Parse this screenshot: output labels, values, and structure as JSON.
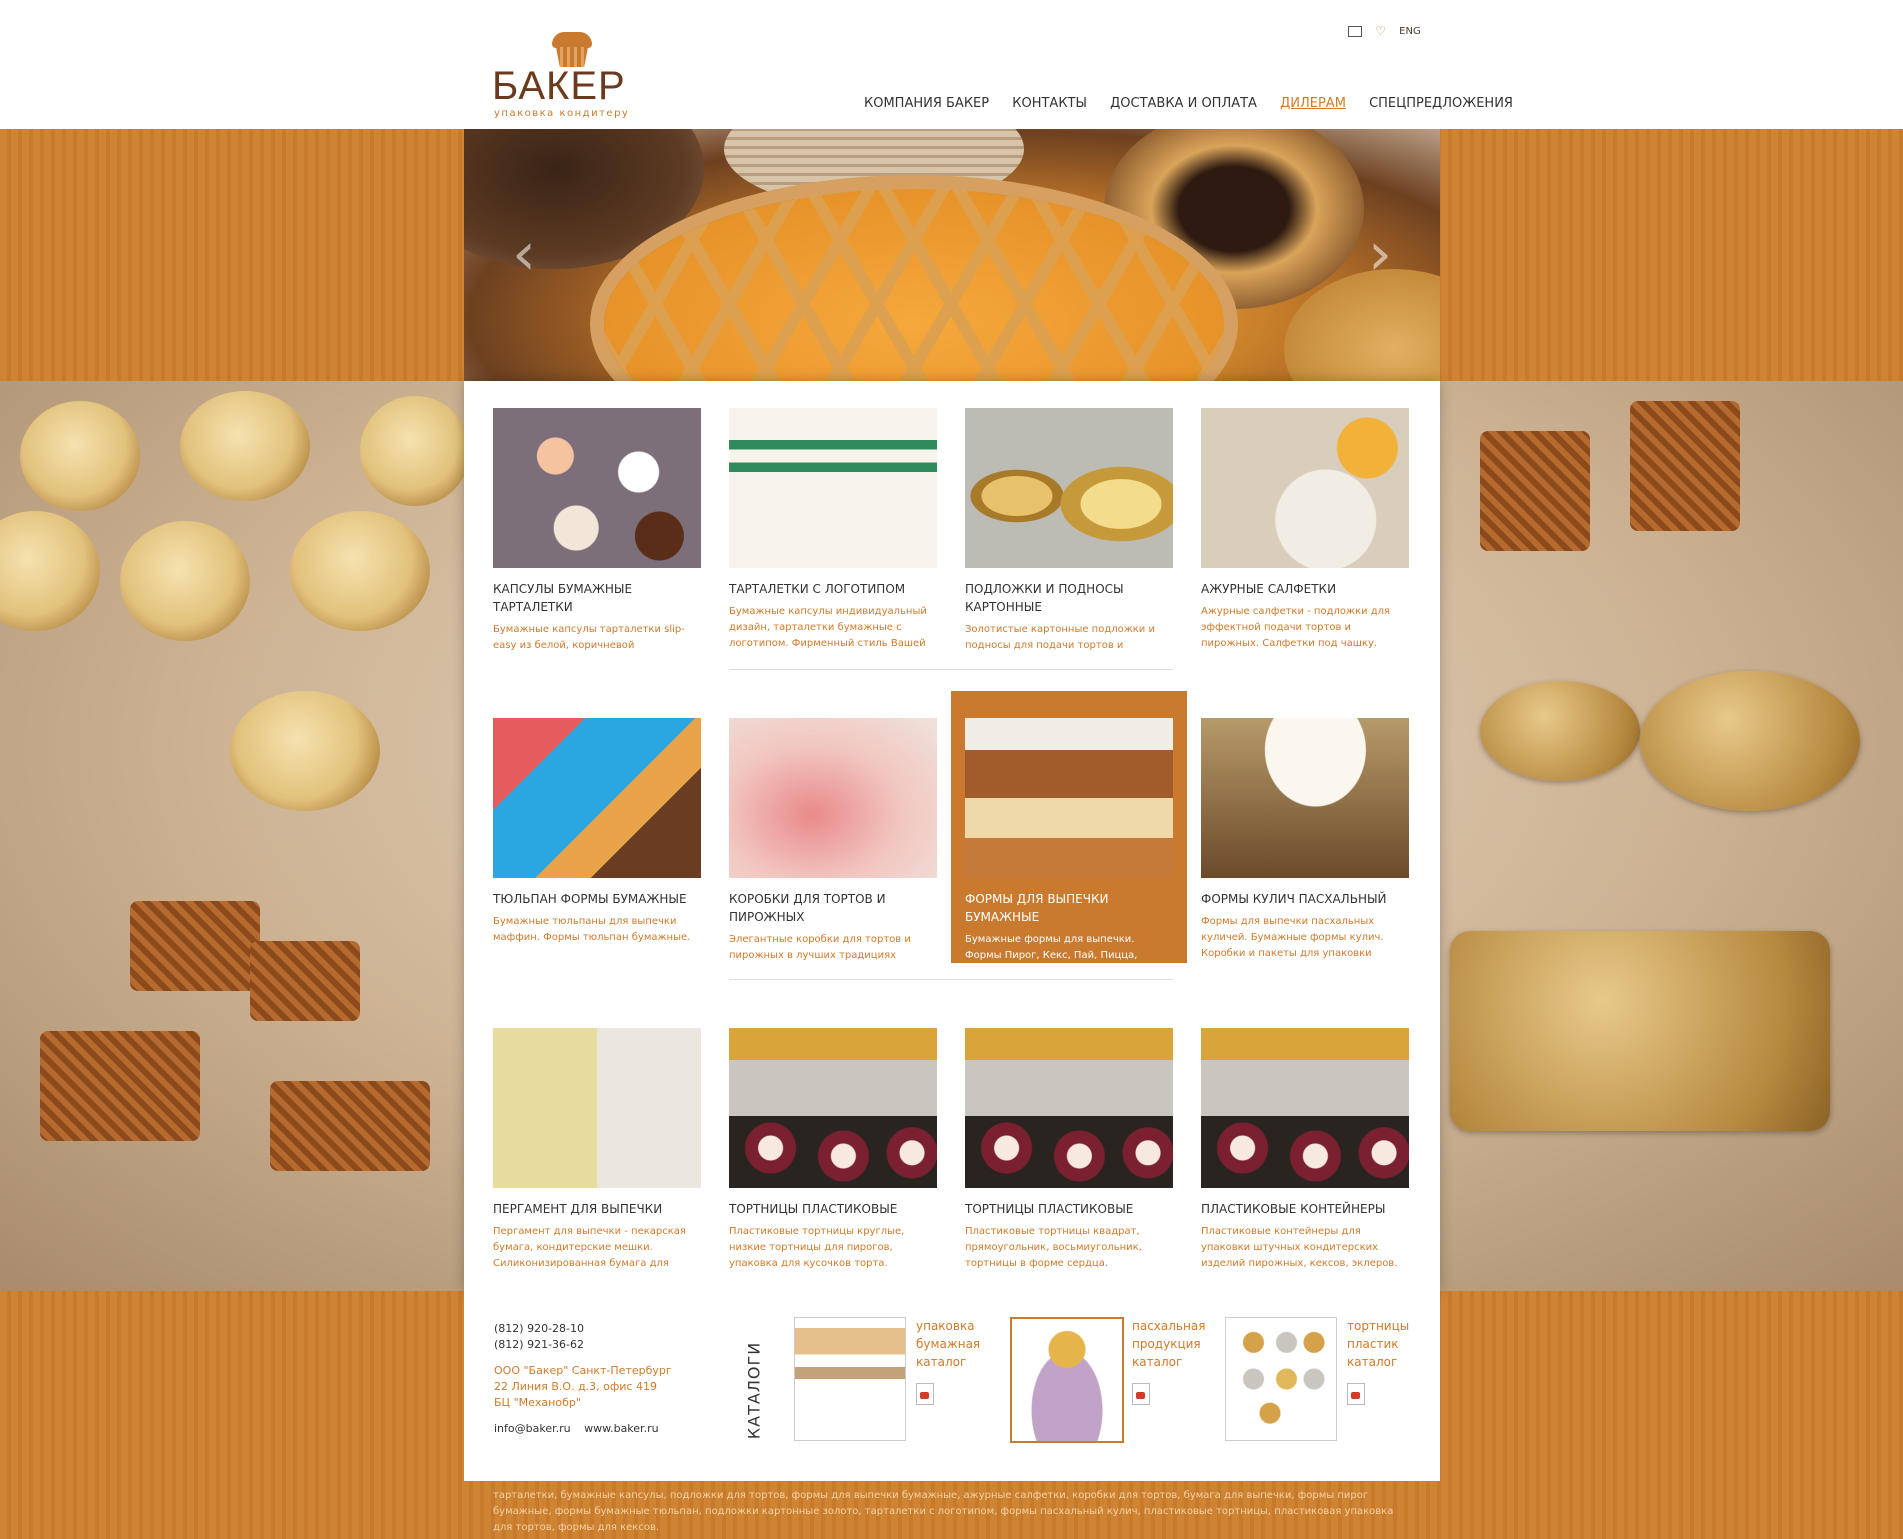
{
  "header": {
    "logo_title": "БАКЕР",
    "logo_sub": "упаковка кондитеру",
    "lang": "ENG",
    "nav": [
      {
        "label": "КОМПАНИЯ БАКЕР"
      },
      {
        "label": "КОНТАКТЫ"
      },
      {
        "label": "ДОСТАВКА И ОПЛАТА"
      },
      {
        "label": "ДИЛЕРАМ",
        "active": true
      },
      {
        "label": "СПЕЦПРЕДЛОЖЕНИЯ"
      }
    ]
  },
  "slider": {
    "prev_icon": "chevron-left-icon",
    "next_icon": "chevron-right-icon"
  },
  "products": [
    {
      "title": "КАПСУЛЫ БУМАЖНЫЕ ТАРТАЛЕТКИ",
      "desc": "Бумажные капсулы тарталетки slip-easy из белой, коричневой"
    },
    {
      "title": "ТАРТАЛЕТКИ С ЛОГОТИПОМ",
      "desc": "Бумажные капсулы индивидуальный дизайн, тарталетки бумажные с логотипом. Фирменный стиль Вашей"
    },
    {
      "title": "ПОДЛОЖКИ И ПОДНОСЫ КАРТОННЫЕ",
      "desc": "Золотистые картонные подложки и подносы для подачи тортов и"
    },
    {
      "title": "АЖУРНЫЕ САЛФЕТКИ",
      "desc": "Ажурные салфетки - подложки для эффектной подачи тортов и пирожных. Салфетки под чашку."
    },
    {
      "title": "ТЮЛЬПАН ФОРМЫ БУМАЖНЫЕ",
      "desc": "Бумажные тюльпаны для выпечки маффин. Формы тюльпан бумажные."
    },
    {
      "title": "КОРОБКИ ДЛЯ ТОРТОВ И ПИРОЖНЫХ",
      "desc": "Элегантные коробки для тортов и пирожных в лучших традициях"
    },
    {
      "title": "ФОРМЫ ДЛЯ ВЫПЕЧКИ БУМАЖНЫЕ",
      "desc": "Бумажные формы для выпечки. Формы Пирог, Кекс, Пай, Пицца, фигурные формы."
    },
    {
      "title": "ФОРМЫ КУЛИЧ ПАСХАЛЬНЫЙ",
      "desc": "Формы для выпечки пасхальных куличей. Бумажные формы кулич. Коробки и пакеты для упаковки"
    },
    {
      "title": "ПЕРГАМЕНТ ДЛЯ ВЫПЕЧКИ",
      "desc": "Пергамент для выпечки - пекарская бумага, кондитерские мешки. Силиконизированная бумага для"
    },
    {
      "title": "ТОРТНИЦЫ ПЛАСТИКОВЫЕ",
      "desc": "Пластиковые тортницы круглые, низкие тортницы для пирогов, упаковка для кусочков торта."
    },
    {
      "title": "ТОРТНИЦЫ ПЛАСТИКОВЫЕ",
      "desc": "Пластиковые тортницы квадрат, прямоугольник, восьмиугольник, тортницы в форме сердца."
    },
    {
      "title": "ПЛАСТИКОВЫЕ КОНТЕЙНЕРЫ",
      "desc": "Пластиковые контейнеры для упаковки штучных кондитерских изделий пирожных, кексов, эклеров."
    }
  ],
  "footer": {
    "phone1": "(812) 920-28-10",
    "phone2": "(812) 921-36-62",
    "addr1": "ООО \"Бакер\" Санкт-Петербург",
    "addr2": "22 Линия В.О. д.3, офис 419",
    "addr3": "БЦ \"Механобр\"",
    "email": "info@baker.ru",
    "site": "www.baker.ru",
    "catalogs_label": "КАТАЛОГИ",
    "catalogs": [
      {
        "l1": "упаковка",
        "l2": "бумажная",
        "l3": "каталог"
      },
      {
        "l1": "пасхальная",
        "l2": "продукция",
        "l3": "каталог"
      },
      {
        "l1": "тортницы",
        "l2": "пластик",
        "l3": "каталог"
      }
    ]
  },
  "seo_text": "тарталетки, бумажные капсулы, подложки для тортов, формы для выпечки бумажные, ажурные салфетки, коробки для тортов, бумага для выпечки, формы пирог бумажные, формы бумажные тюльпан, подложки картонные золото, тарталетки с логотипом, формы пасхальный кулич, пластиковые тортницы, пластиковая упаковка для тортов, формы для кексов."
}
